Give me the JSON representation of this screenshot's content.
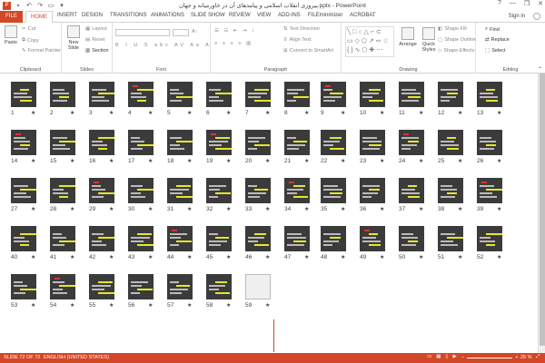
{
  "titlebar": {
    "title": "پیروزی انقلاب اسلامی و پیامدهای آن در خاورمیانه و جهان.pptx - PowerPoint",
    "qat_icons": [
      "save-icon",
      "undo-icon",
      "redo-icon",
      "start-presentation-icon"
    ],
    "window_controls": [
      "?",
      "—",
      "❐",
      "✕"
    ]
  },
  "tabs": [
    "FILE",
    "HOME",
    "INSERT",
    "DESIGN",
    "TRANSITIONS",
    "ANIMATIONS",
    "SLIDE SHOW",
    "REVIEW",
    "VIEW",
    "ADD-INS",
    "FILEminimizer",
    "ACROBAT"
  ],
  "sign_in": "Sign in",
  "ribbon": {
    "clipboard": {
      "label": "Clipboard",
      "paste": "Paste",
      "cut": "Cut",
      "copy": "Copy",
      "format_painter": "Format Painter"
    },
    "slides": {
      "label": "Slides",
      "new_slide": "New Slide",
      "layout": "Layout",
      "reset": "Reset",
      "section": "Section"
    },
    "font": {
      "label": "Font"
    },
    "paragraph": {
      "label": "Paragraph",
      "text_direction": "Text Direction",
      "align_text": "Align Text",
      "convert": "Convert to SmartArt"
    },
    "drawing": {
      "label": "Drawing",
      "arrange": "Arrange",
      "quick_styles": "Quick Styles",
      "shape_fill": "Shape Fill",
      "shape_outline": "Shape Outline",
      "shape_effects": "Shape Effects"
    },
    "editing": {
      "label": "Editing",
      "find": "Find",
      "replace": "Replace",
      "select": "Select"
    }
  },
  "slides_count": 59,
  "status": {
    "slide": "SLIDE 72 OF 72",
    "language": "ENGLISH (UNITED STATES)",
    "zoom": "25 %"
  }
}
